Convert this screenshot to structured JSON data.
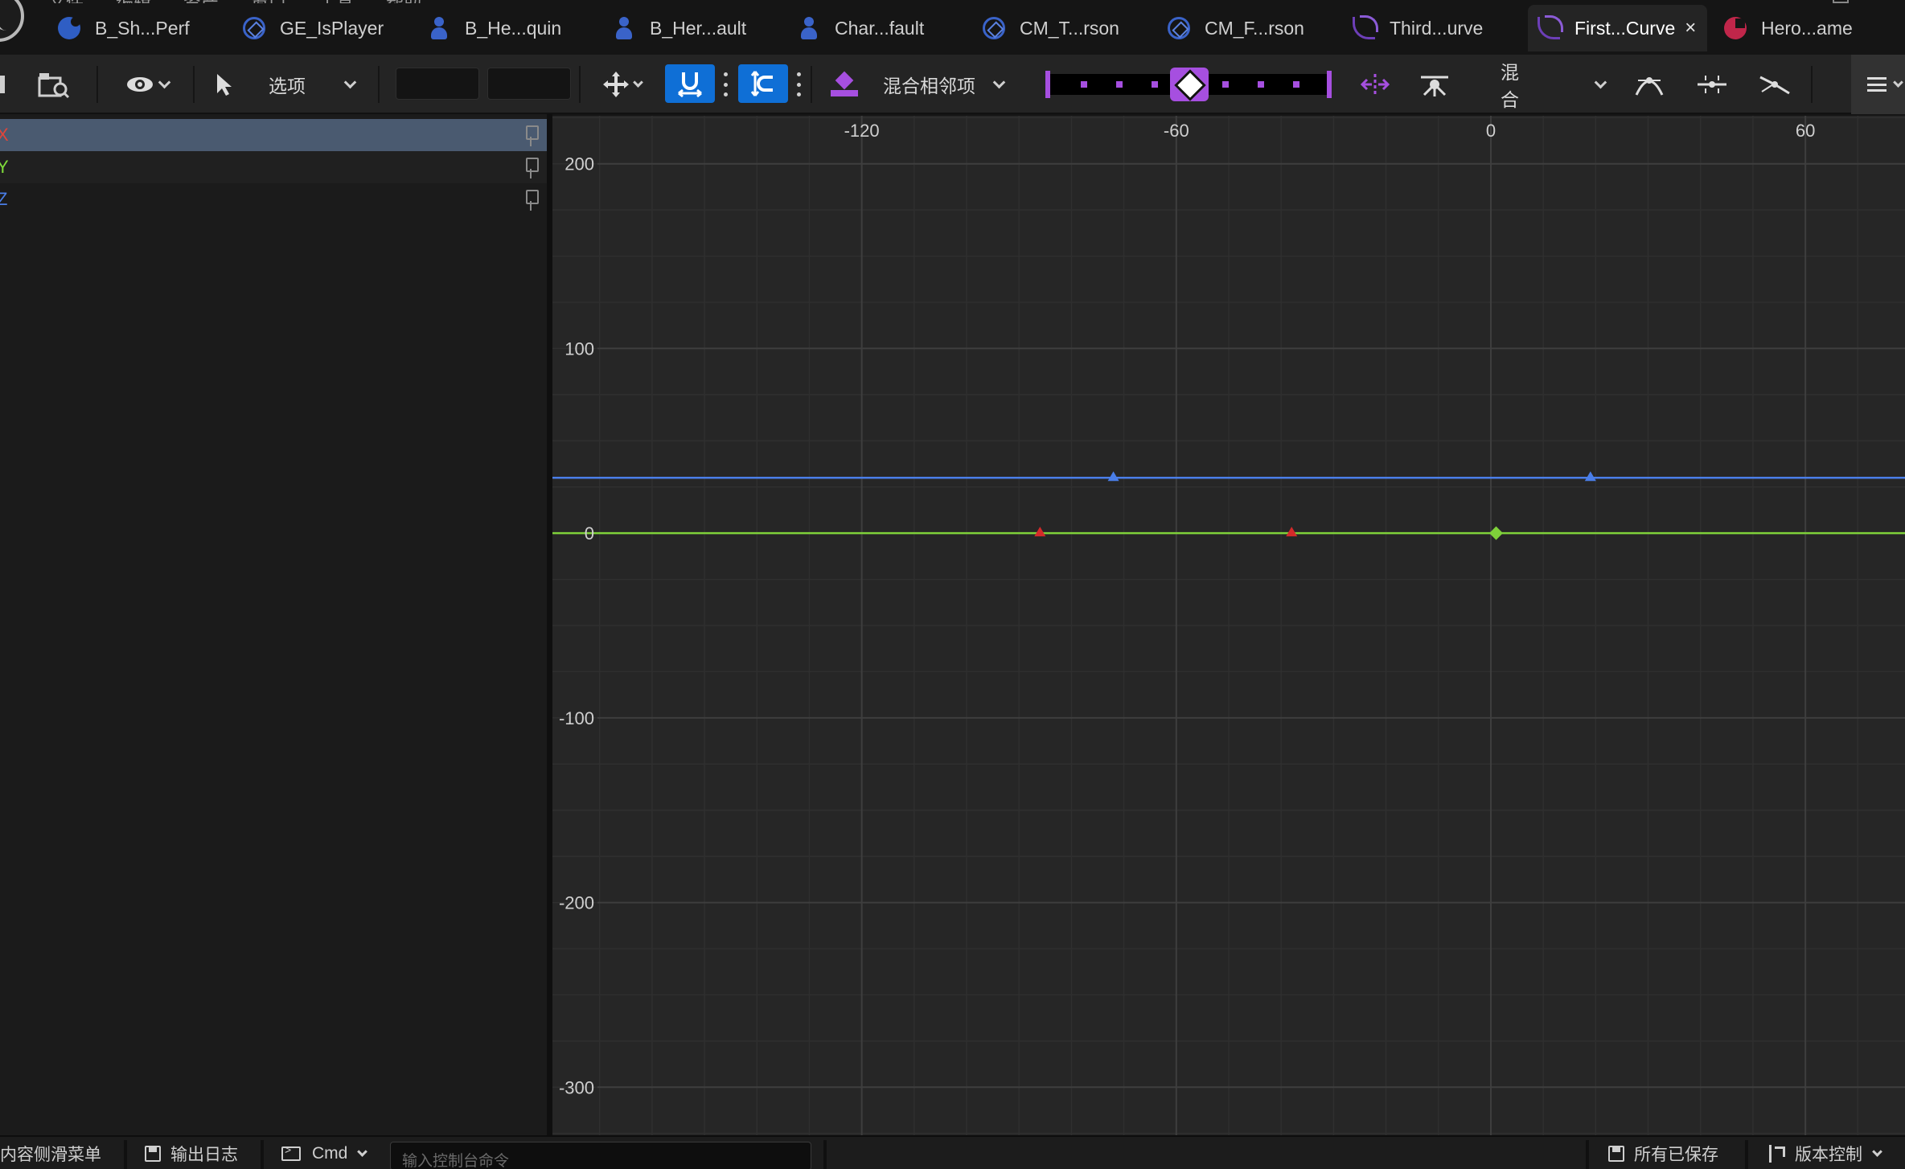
{
  "tabs": [
    {
      "label": "B_Sh...Perf",
      "icon": "blueprint-icon"
    },
    {
      "label": "GE_IsPlayer",
      "icon": "gameplay-effect-icon"
    },
    {
      "label": "B_He...quin",
      "icon": "character-icon"
    },
    {
      "label": "B_Her...ault",
      "icon": "character-icon"
    },
    {
      "label": "Char...fault",
      "icon": "character-icon"
    },
    {
      "label": "CM_T...rson",
      "icon": "camera-mode-icon"
    },
    {
      "label": "CM_F...rson",
      "icon": "camera-mode-icon"
    },
    {
      "label": "Third...urve",
      "icon": "curve-icon"
    },
    {
      "label": "First...Curve",
      "icon": "curve-icon",
      "active": true
    },
    {
      "label": "Hero...ame",
      "icon": "game-data-icon"
    }
  ],
  "active_tab_close": "×",
  "toolbar": {
    "options_label": "选项",
    "blend_neighbors_label": "混合相邻项",
    "blend_label": "混合",
    "time_input_value": "",
    "value_input_value": ""
  },
  "channels": [
    {
      "label": "X",
      "color": "#e0453a",
      "selected": true
    },
    {
      "label": "Y",
      "color": "#7fdc3a",
      "selected": false
    },
    {
      "label": "Z",
      "color": "#4a7ee8",
      "selected": false
    }
  ],
  "chart_data": {
    "type": "line",
    "x_tick_labels": [
      "-120",
      "-60",
      "0",
      "60"
    ],
    "y_tick_labels": [
      "200",
      "100",
      "0",
      "-100",
      "-200",
      "-300"
    ],
    "xlim": [
      -179,
      79
    ],
    "ylim": [
      -326,
      226
    ],
    "series": [
      {
        "name": "X",
        "color": "#d42a2a",
        "x": [
          -86,
          -38
        ],
        "y": [
          0,
          0
        ]
      },
      {
        "name": "Y",
        "color": "#7fd13a",
        "x": [
          1
        ],
        "y": [
          0
        ]
      },
      {
        "name": "Z",
        "color": "#4a7ee8",
        "x": [
          -72,
          19
        ],
        "y": [
          30,
          30
        ]
      }
    ]
  },
  "statusbar": {
    "content_drawer_label": "内容侧滑菜单",
    "output_log_label": "输出日志",
    "cmd_label": "Cmd",
    "console_placeholder": "输入控制台命令",
    "all_saved_label": "所有已保存",
    "source_control_label": "版本控制"
  }
}
